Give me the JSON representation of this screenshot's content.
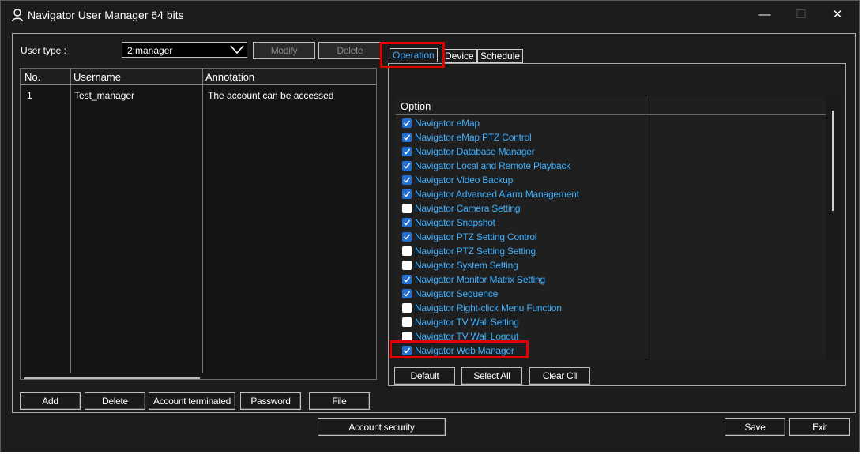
{
  "window": {
    "title": "Navigator User Manager 64 bits",
    "controls": {
      "minimize": "—",
      "maximize": "☐",
      "close": "✕"
    }
  },
  "user_type": {
    "label": "User type :",
    "selected": "2:manager",
    "modify_label": "Modify",
    "delete_label": "Delete"
  },
  "accounts": {
    "columns": [
      "No.",
      "Username",
      "Annotation"
    ],
    "rows": [
      {
        "no": "1",
        "username": "Test_manager",
        "annotation": "The account can be accessed"
      }
    ]
  },
  "account_buttons": {
    "add": "Add",
    "delete": "Delete",
    "terminated": "Account terminated",
    "password": "Password",
    "file": "File"
  },
  "tabs": [
    {
      "label": "Operation",
      "active": true
    },
    {
      "label": "Device",
      "active": false
    },
    {
      "label": "Schedule",
      "active": false
    }
  ],
  "options": {
    "header": "Option",
    "items": [
      {
        "label": "Navigator eMap",
        "checked": true
      },
      {
        "label": "Navigator eMap PTZ Control",
        "checked": true
      },
      {
        "label": "Navigator Database Manager",
        "checked": true
      },
      {
        "label": "Navigator Local and Remote Playback",
        "checked": true
      },
      {
        "label": "Navigator Video Backup",
        "checked": true
      },
      {
        "label": "Navigator Advanced Alarm Management",
        "checked": true
      },
      {
        "label": "Navigator Camera Setting",
        "checked": false
      },
      {
        "label": "Navigator Snapshot",
        "checked": true
      },
      {
        "label": "Navigator PTZ Setting Control",
        "checked": true
      },
      {
        "label": "Navigator PTZ Setting Setting",
        "checked": false
      },
      {
        "label": "Navigator System Setting",
        "checked": false
      },
      {
        "label": "Navigator Monitor Matrix Setting",
        "checked": true
      },
      {
        "label": "Navigator Sequence",
        "checked": true
      },
      {
        "label": "Navigator Right-click Menu Function",
        "checked": false
      },
      {
        "label": "Navigator TV Wall Setting",
        "checked": false
      },
      {
        "label": "Navigator TV Wall Logout",
        "checked": false
      },
      {
        "label": "Navigator Web Manager",
        "checked": true
      }
    ]
  },
  "option_buttons": {
    "default": "Default",
    "select_all": "Select All",
    "clear_all": "Clear Cll"
  },
  "footer": {
    "account_security": "Account security",
    "save": "Save",
    "exit": "Exit"
  },
  "colors": {
    "background": "#1c1c1c",
    "highlight": "#e00000",
    "link_text": "#3fb0ff",
    "checkbox_checked": "#1f6fd6"
  }
}
